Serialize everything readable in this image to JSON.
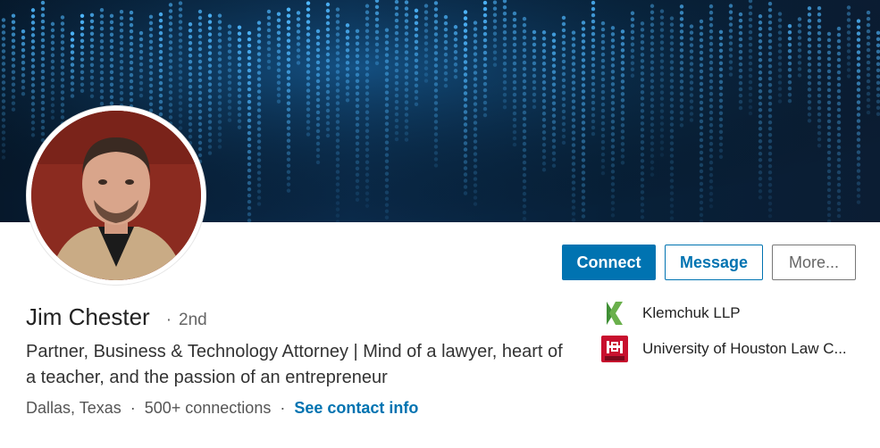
{
  "profile": {
    "name": "Jim Chester",
    "degree": "2nd",
    "headline": "Partner, Business & Technology Attorney | Mind of a lawyer, heart of a teacher, and the passion of an entrepreneur",
    "location": "Dallas, Texas",
    "connections": "500+ connections",
    "contact_link": "See contact info"
  },
  "actions": {
    "connect_label": "Connect",
    "message_label": "Message",
    "more_label": "More..."
  },
  "experience": [
    {
      "label": "Klemchuk LLP",
      "icon": "klemchuk-logo"
    },
    {
      "label": "University of Houston Law C...",
      "icon": "uh-law-logo"
    }
  ],
  "colors": {
    "primary": "#0073b1",
    "banner": "#06182b",
    "klemchuk_green": "#4a9a3e",
    "uh_red": "#c8102e"
  }
}
